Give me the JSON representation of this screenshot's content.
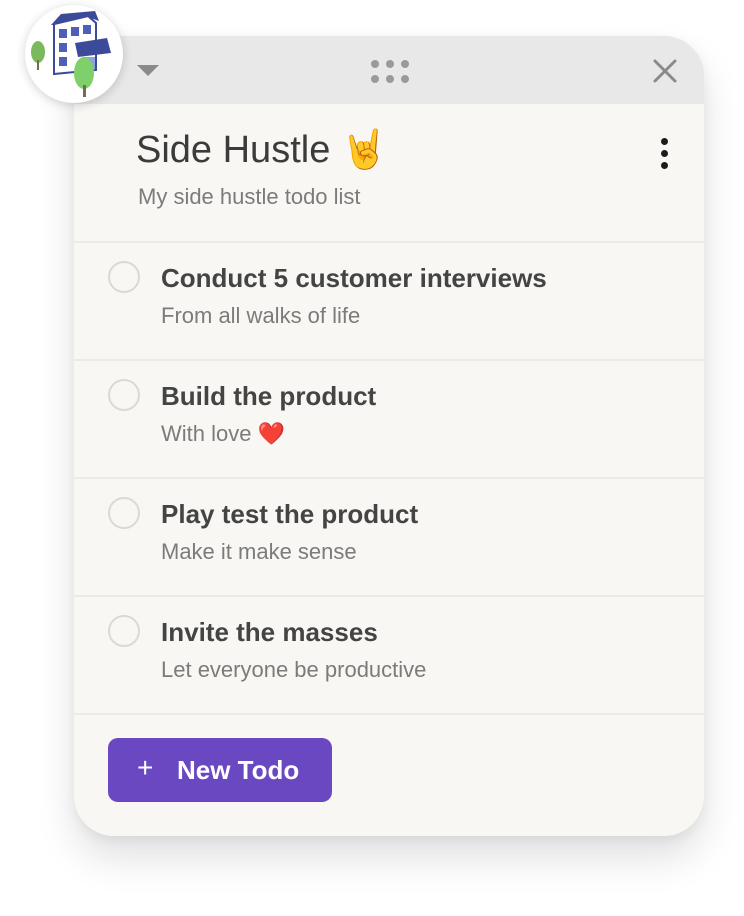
{
  "header": {
    "title": "Side Hustle 🤘",
    "subtitle": "My side hustle todo list"
  },
  "todos": [
    {
      "title": "Conduct 5 customer interviews",
      "note": "From all walks of life",
      "done": false
    },
    {
      "title": "Build the product",
      "note": "With love ❤️",
      "done": false
    },
    {
      "title": "Play test the product",
      "note": "Make it make sense",
      "done": false
    },
    {
      "title": "Invite the masses",
      "note": "Let everyone be productive",
      "done": false
    }
  ],
  "footer": {
    "new_todo_icon": "+",
    "new_todo_label": "New Todo"
  },
  "icons": {
    "avatar": "house-icon",
    "dropdown": "caret-down-icon",
    "drag": "drag-handle-icon",
    "close": "close-icon",
    "more": "more-vertical-icon"
  },
  "colors": {
    "accent": "#6a48c2",
    "panel": "#f8f7f4",
    "titlebar": "#e8e8e8"
  }
}
